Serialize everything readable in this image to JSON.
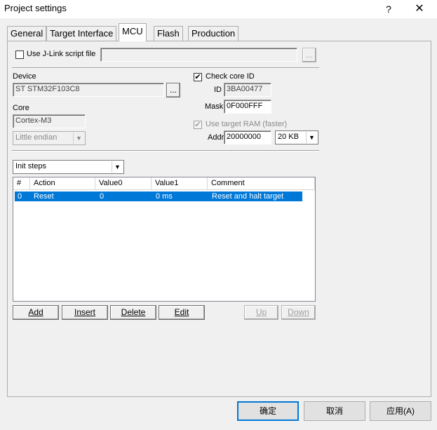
{
  "window": {
    "title": "Project settings",
    "help_symbol": "?",
    "close_symbol": "✕"
  },
  "tabs": [
    {
      "label": "General"
    },
    {
      "label": "Target Interface"
    },
    {
      "label": "MCU"
    },
    {
      "label": "Flash"
    },
    {
      "label": "Production"
    }
  ],
  "script_file": {
    "label": "Use J-Link script file",
    "value": "",
    "browse_label": "..."
  },
  "device": {
    "label": "Device",
    "value": "ST STM32F103C8",
    "browse_label": "..."
  },
  "core": {
    "label": "Core",
    "value": "Cortex-M3",
    "endian": "Little endian"
  },
  "check_core": {
    "label": "Check core ID",
    "id_label": "ID",
    "id_value": "3BA00477",
    "mask_label": "Mask",
    "mask_value": "0F000FFF"
  },
  "target_ram": {
    "label": "Use target RAM (faster)",
    "addr_label": "Addr",
    "addr_value": "20000000",
    "size_value": "20 KB"
  },
  "init_steps": {
    "selected": "Init steps",
    "columns": [
      "#",
      "Action",
      "Value0",
      "Value1",
      "Comment"
    ],
    "rows": [
      {
        "num": "0",
        "action": "Reset",
        "value0": "0",
        "value1": "0 ms",
        "comment": "Reset and halt target"
      }
    ]
  },
  "actions": {
    "add": "Add",
    "insert": "Insert",
    "delete": "Delete",
    "edit": "Edit",
    "up": "Up",
    "down": "Down"
  },
  "dialog": {
    "ok": "确定",
    "cancel": "取消",
    "apply": "应用(A)"
  }
}
